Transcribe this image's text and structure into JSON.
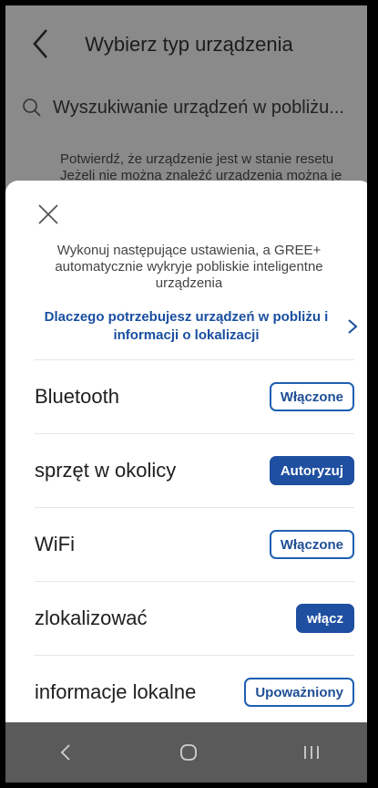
{
  "header": {
    "title": "Wybierz typ urządzenia",
    "back_icon": "chevron-left-icon"
  },
  "search": {
    "text": "Wyszukiwanie urządzeń w pobliżu...",
    "icon": "search-icon"
  },
  "hint": {
    "line1": "Potwierdź, że urządzenie jest w stanie resetu",
    "line2": "Jeżeli nie można znaleźć urządzenia można je"
  },
  "sheet": {
    "close_icon": "close-icon",
    "intro": "Wykonuj następujące ustawienia, a GREE+ automatycznie wykryje pobliskie inteligentne urządzenia",
    "why_link": "Dlaczego potrzebujesz urządzeń w pobliżu i informacji o lokalizacji",
    "rows": [
      {
        "label": "Bluetooth",
        "button": "Włączone",
        "style": "outline"
      },
      {
        "label": "sprzęt w okolicy",
        "button": "Autoryzuj",
        "style": "solid"
      },
      {
        "label": "WiFi",
        "button": "Włączone",
        "style": "outline"
      },
      {
        "label": "zlokalizować",
        "button": "włącz",
        "style": "solid"
      },
      {
        "label": "informacje lokalne",
        "button": "Upoważniony",
        "style": "outline"
      }
    ]
  },
  "navbar": {
    "back": "nav-back-icon",
    "home": "nav-home-icon",
    "recents": "nav-recents-icon"
  },
  "colors": {
    "accent": "#1f4fa0",
    "link": "#1a4fa0",
    "dim_overlay": "#8a8a8a",
    "navbar": "#5a5a5a"
  }
}
